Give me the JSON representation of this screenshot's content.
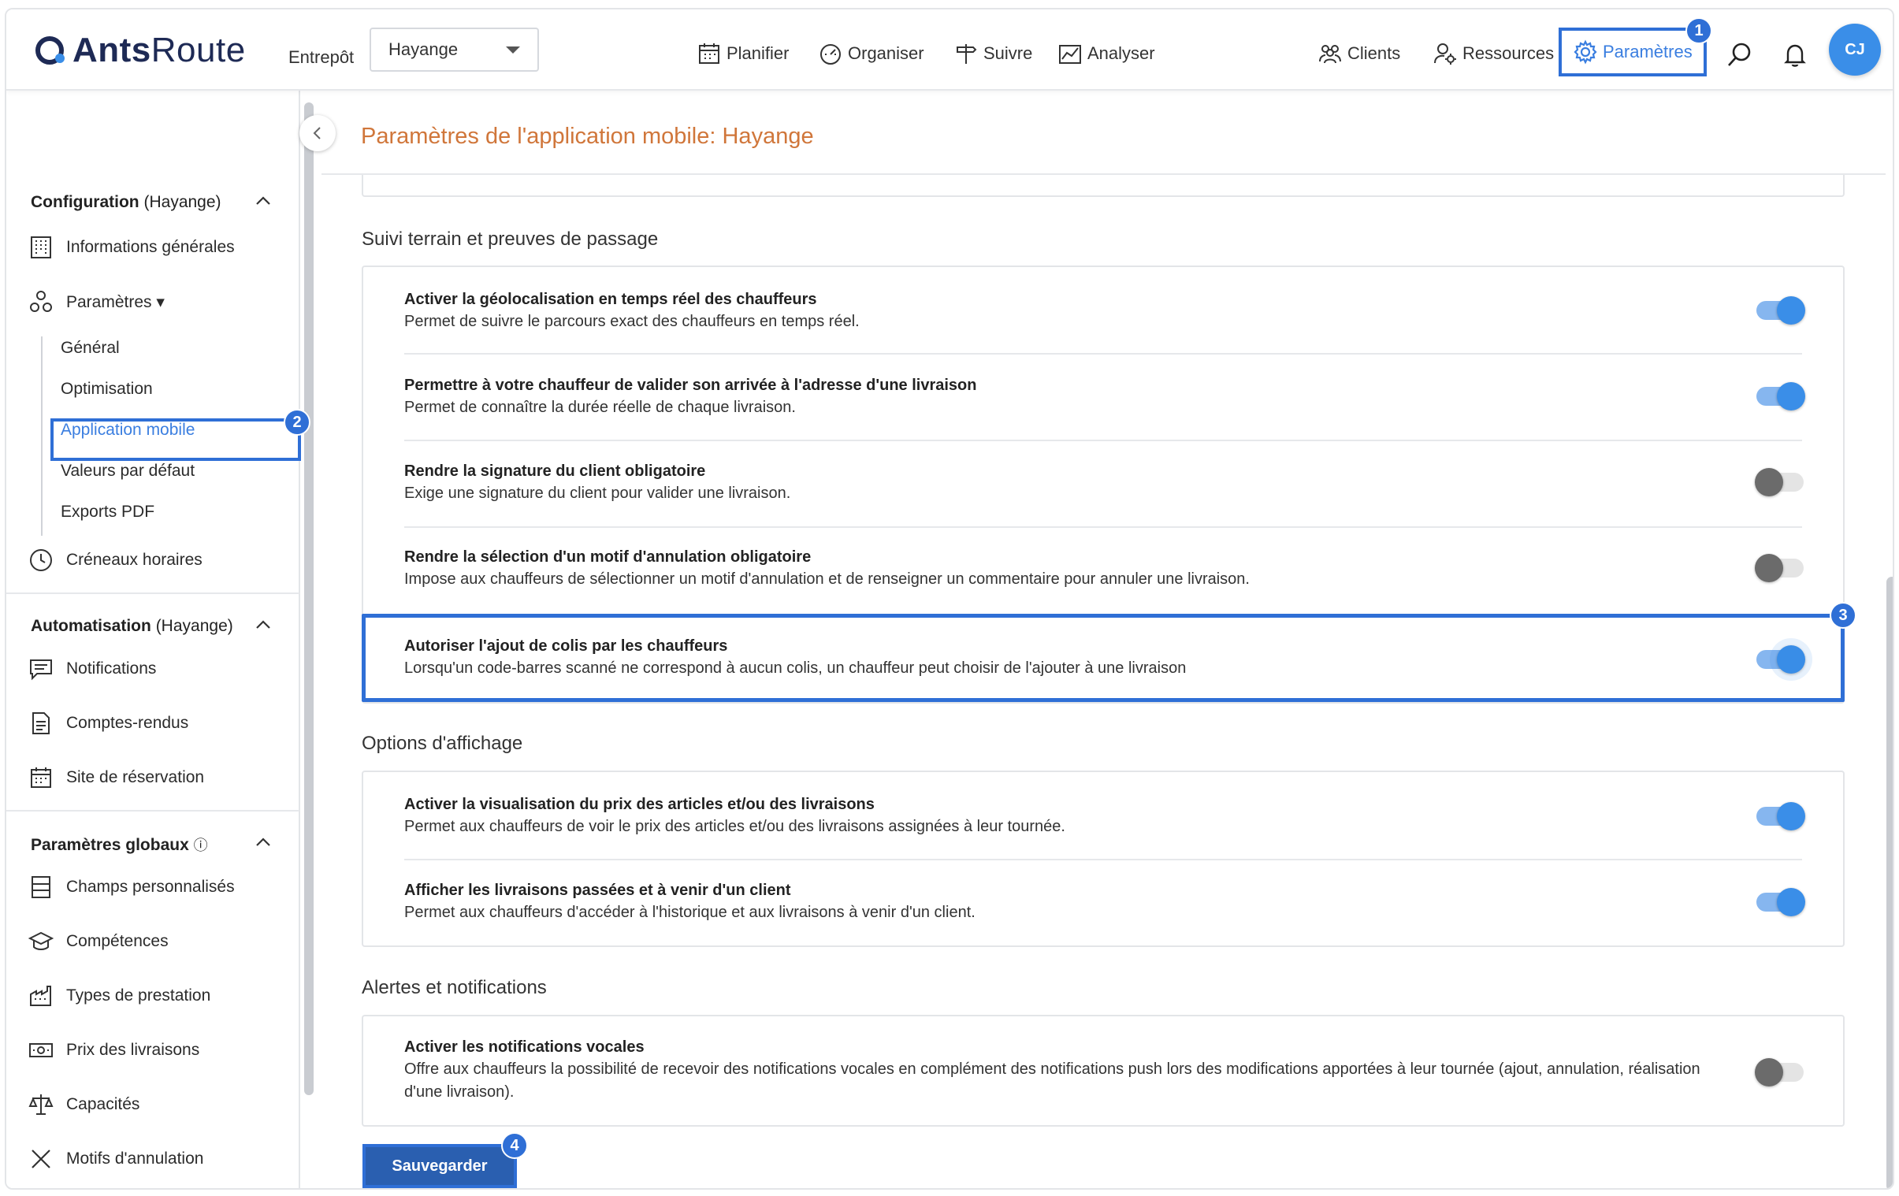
{
  "app": {
    "logo_bold": "Ants",
    "logo_regular": "Route"
  },
  "header": {
    "warehouse_label": "Entrepôt",
    "warehouse_value": "Hayange",
    "nav": [
      "Planifier",
      "Organiser",
      "Suivre",
      "Analyser"
    ],
    "right_nav": [
      "Clients",
      "Ressources",
      "Paramètres"
    ],
    "avatar_initials": "CJ"
  },
  "steps": [
    "1",
    "2",
    "3",
    "4"
  ],
  "sidebar": {
    "config": {
      "title": "Configuration",
      "scope": "(Hayange)"
    },
    "general_info": "Informations générales",
    "settings": "Paramètres ▾",
    "sub_items": [
      "Général",
      "Optimisation",
      "Application mobile",
      "Valeurs par défaut",
      "Exports PDF"
    ],
    "time_slots": "Créneaux horaires",
    "automation": {
      "title": "Automatisation",
      "scope": "(Hayange)"
    },
    "automation_items": [
      "Notifications",
      "Comptes-rendus",
      "Site de réservation"
    ],
    "global": {
      "title": "Paramètres globaux",
      "info_icon": "ⓘ"
    },
    "global_items": [
      "Champs personnalisés",
      "Compétences",
      "Types de prestation",
      "Prix des livraisons",
      "Capacités",
      "Motifs d'annulation"
    ]
  },
  "page": {
    "title": "Paramètres de l'application mobile: Hayange"
  },
  "groups": [
    {
      "title": "Suivi terrain et preuves de passage",
      "rows": [
        {
          "title": "Activer la géolocalisation en temps réel des chauffeurs",
          "desc": "Permet de suivre le parcours exact des chauffeurs en temps réel.",
          "on": true
        },
        {
          "title": "Permettre à votre chauffeur de valider son arrivée à l'adresse d'une livraison",
          "desc": "Permet de connaître la durée réelle de chaque livraison.",
          "on": true
        },
        {
          "title": "Rendre la signature du client obligatoire",
          "desc": "Exige une signature du client pour valider une livraison.",
          "on": false
        },
        {
          "title": "Rendre la sélection d'un motif d'annulation obligatoire",
          "desc": "Impose aux chauffeurs de sélectionner un motif d'annulation et de renseigner un commentaire pour annuler une livraison.",
          "on": false
        },
        {
          "title": "Autoriser l'ajout de colis par les chauffeurs",
          "desc": "Lorsqu'un code-barres scanné ne correspond à aucun colis, un chauffeur peut choisir de l'ajouter à une livraison",
          "on": true
        }
      ]
    },
    {
      "title": "Options d'affichage",
      "rows": [
        {
          "title": "Activer la visualisation du prix des articles et/ou des livraisons",
          "desc": "Permet aux chauffeurs de voir le prix des articles et/ou des livraisons assignées à leur tournée.",
          "on": true
        },
        {
          "title": "Afficher les livraisons passées et à venir d'un client",
          "desc": "Permet aux chauffeurs d'accéder à l'historique et aux livraisons à venir d'un client.",
          "on": true
        }
      ]
    },
    {
      "title": "Alertes et notifications",
      "rows": [
        {
          "title": "Activer les notifications vocales",
          "desc": "Offre aux chauffeurs la possibilité de recevoir des notifications vocales en complément des notifications push lors des modifications apportées à leur tournée (ajout, annulation, réalisation d'une livraison).",
          "on": false
        }
      ]
    }
  ],
  "actions": {
    "save": "Sauvegarder"
  },
  "colors": {
    "accent": "#2f6fd6",
    "title_orange": "#d0763a",
    "toggle_on": "#3a8ee8",
    "toggle_off": "#6b6b6b"
  }
}
